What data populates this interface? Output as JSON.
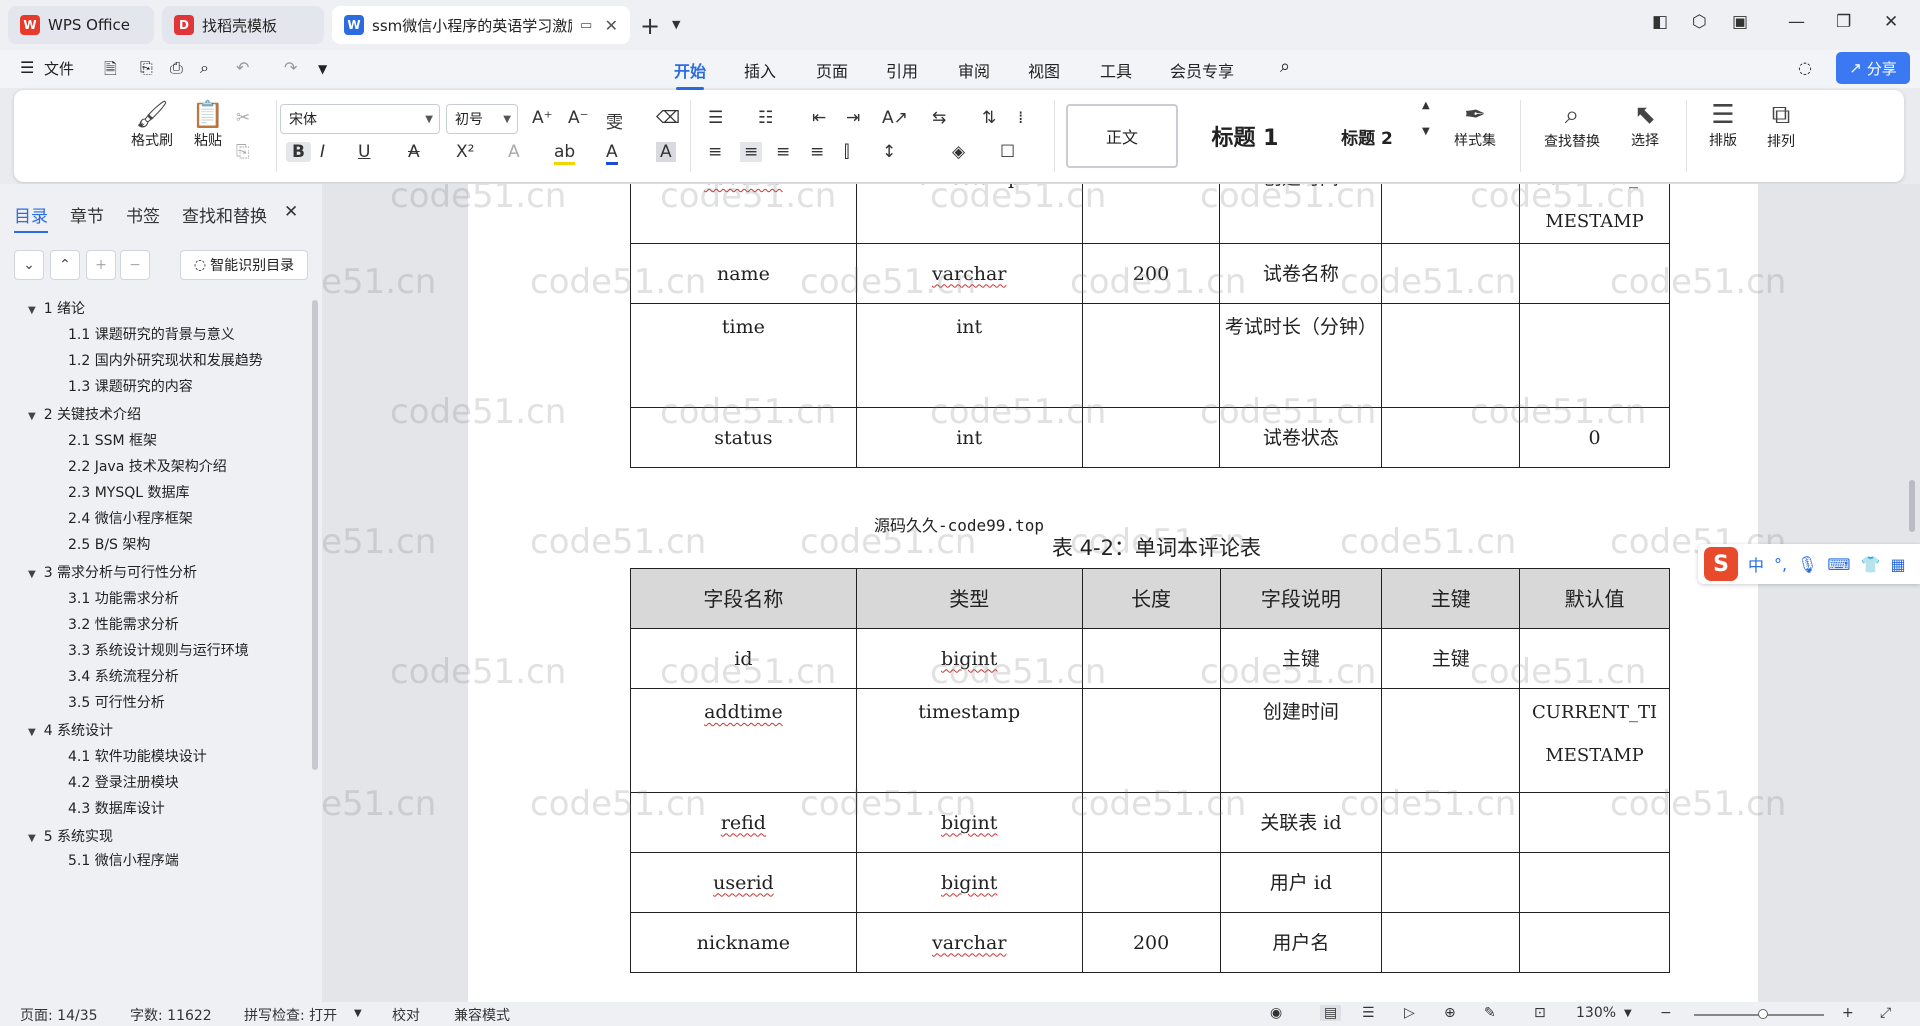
{
  "titlebar": {
    "tabs": [
      {
        "label": "WPS Office",
        "icon": "W",
        "color": "#e83a2a"
      },
      {
        "label": "找稻壳模板",
        "icon": "D",
        "color": "#e0363a"
      },
      {
        "label": "ssm微信小程序的英语学习激励",
        "icon": "W",
        "color": "#2b6de0"
      }
    ]
  },
  "menu": {
    "file": "文件",
    "items": [
      "开始",
      "插入",
      "页面",
      "引用",
      "审阅",
      "视图",
      "工具",
      "会员专享"
    ],
    "share": "分享"
  },
  "ribbon": {
    "format_painter": "格式刷",
    "paste": "粘贴",
    "font_name": "宋体",
    "font_size": "初号",
    "style_normal": "正文",
    "style_h1": "标题 1",
    "style_h2": "标题 2",
    "style_set": "样式集",
    "find_replace": "查找替换",
    "select": "选择",
    "layout": "排版",
    "arrange": "排列"
  },
  "panel": {
    "tabs": [
      "目录",
      "章节",
      "书签",
      "查找和替换"
    ],
    "smart_toc": "智能识别目录",
    "toc": [
      {
        "label": "1 绪论",
        "level": 1
      },
      {
        "label": "1.1  课题研究的背景与意义",
        "level": 2
      },
      {
        "label": "1.2  国内外研究现状和发展趋势",
        "level": 2
      },
      {
        "label": "1.3  课题研究的内容",
        "level": 2
      },
      {
        "label": "2  关键技术介绍",
        "level": 1
      },
      {
        "label": "2.1 SSM 框架",
        "level": 2
      },
      {
        "label": "2.2 Java 技术及架构介绍",
        "level": 2
      },
      {
        "label": "2.3 MYSQL 数据库",
        "level": 2
      },
      {
        "label": "2.4 微信小程序框架",
        "level": 2
      },
      {
        "label": "2.5 B/S 架构",
        "level": 2
      },
      {
        "label": "3  需求分析与可行性分析",
        "level": 1
      },
      {
        "label": "3.1 功能需求分析",
        "level": 2
      },
      {
        "label": "3.2  性能需求分析",
        "level": 2
      },
      {
        "label": "3.3 系统设计规则与运行环境",
        "level": 2
      },
      {
        "label": "3.4 系统流程分析",
        "level": 2
      },
      {
        "label": "3.5  可行性分析",
        "level": 2
      },
      {
        "label": "4  系统设计",
        "level": 1
      },
      {
        "label": "4.1 软件功能模块设计",
        "level": 2
      },
      {
        "label": "4.2 登录注册模块",
        "level": 2
      },
      {
        "label": "4.3 数据库设计",
        "level": 2
      },
      {
        "label": "5 系统实现",
        "level": 1
      },
      {
        "label": "5.1 微信小程序端",
        "level": 2
      }
    ]
  },
  "document": {
    "table1_rows": [
      [
        "addtime",
        "timestamp",
        "",
        "创建时间",
        "",
        "CURRENT_TIMESTAMP"
      ],
      [
        "name",
        "varchar",
        "200",
        "试卷名称",
        "",
        ""
      ],
      [
        "time",
        "int",
        "",
        "考试时长（分钟）",
        "",
        ""
      ],
      [
        "status",
        "int",
        "",
        "试卷状态",
        "",
        "0"
      ]
    ],
    "source_note": "源码久久-code99.top",
    "table2_caption": "表 4-2：单词本评论表",
    "table2_header": [
      "字段名称",
      "类型",
      "长度",
      "字段说明",
      "主键",
      "默认值"
    ],
    "table2_rows": [
      [
        "id",
        "bigint",
        "",
        "主键",
        "主键",
        ""
      ],
      [
        "addtime",
        "timestamp",
        "",
        "创建时间",
        "",
        "CURRENT_TIMESTAMP"
      ],
      [
        "refid",
        "bigint",
        "",
        "关联表 id",
        "",
        ""
      ],
      [
        "userid",
        "bigint",
        "",
        "用户 id",
        "",
        ""
      ],
      [
        "nickname",
        "varchar",
        "200",
        "用户名",
        "",
        ""
      ]
    ],
    "watermark": "code51.cn"
  },
  "status": {
    "page": "页面: 14/35",
    "words": "字数: 11622",
    "spell": "拼写检查: 打开",
    "proof": "校对",
    "compat": "兼容模式",
    "zoom": "130%"
  },
  "ime": {
    "lang": "中"
  }
}
